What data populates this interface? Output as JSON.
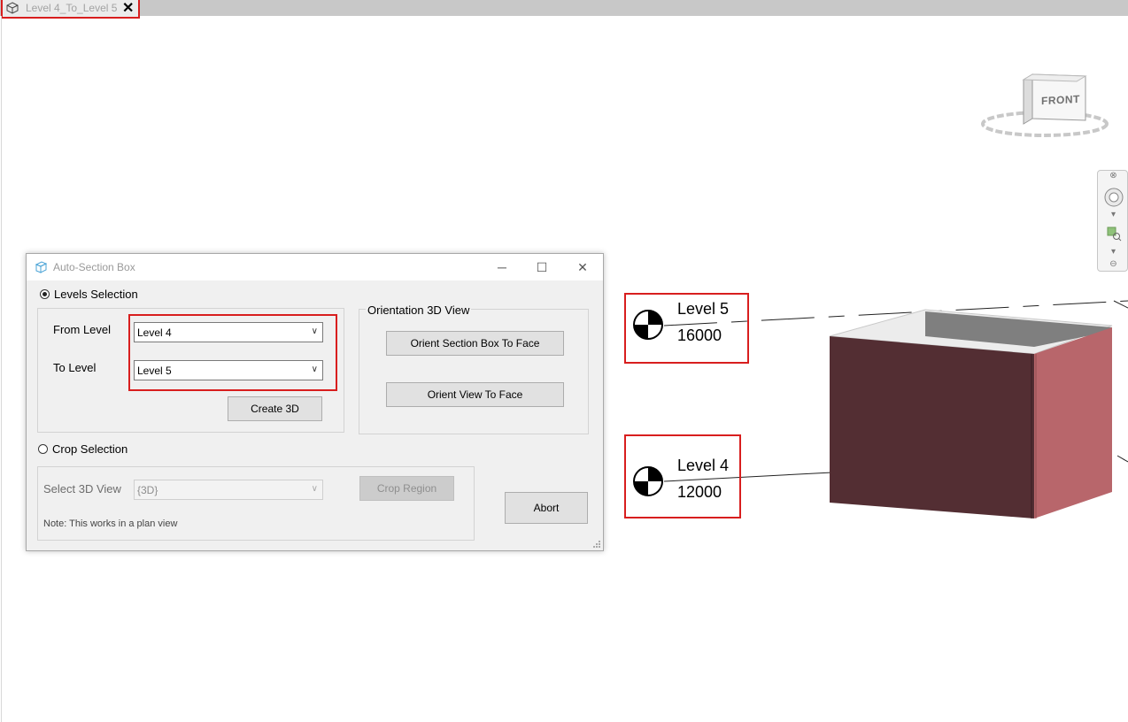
{
  "document_tab": {
    "title": "Level 4_To_Level 5",
    "close_glyph": "✕",
    "icon": "3d-view-icon"
  },
  "viewcube": {
    "face": "FRONT"
  },
  "levels": [
    {
      "name": "Level 5",
      "elevation": "16000"
    },
    {
      "name": "Level 4",
      "elevation": "12000"
    }
  ],
  "dialog": {
    "title": "Auto-Section Box",
    "window_buttons": {
      "minimize": "─",
      "maximize": "☐",
      "close": "✕"
    },
    "levels_selection": {
      "label": "Levels Selection",
      "from_level_label": "From Level",
      "from_level_value": "Level 4",
      "to_level_label": "To Level",
      "to_level_value": "Level 5",
      "create_button": "Create 3D"
    },
    "orientation": {
      "group_label": "Orientation 3D View",
      "orient_section_box_button": "Orient Section Box To Face",
      "orient_view_button": "Orient View To Face"
    },
    "crop_selection": {
      "label": "Crop Selection",
      "select_view_label": "Select 3D View",
      "select_view_value": "{3D}",
      "crop_button": "Crop Region",
      "note": "Note: This works in a plan view"
    },
    "abort_button": "Abort"
  },
  "colors": {
    "highlight": "#d81e1e",
    "box_front": "#532e33",
    "box_side": "#b8666b",
    "box_inner": "#7f7f7f"
  }
}
